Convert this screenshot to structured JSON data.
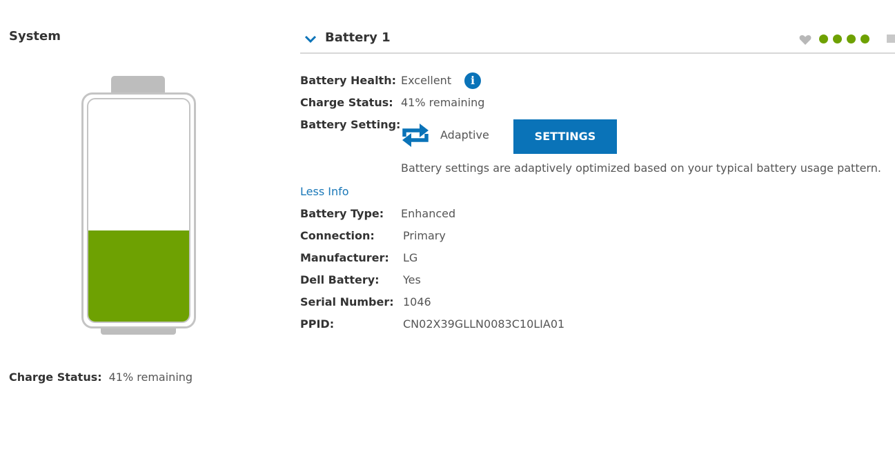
{
  "system": {
    "title": "System"
  },
  "battery_graphic": {
    "charge_level": 0.41,
    "fill_color": "#6ea102"
  },
  "left_charge": {
    "label": "Charge Status:",
    "value": "41% remaining"
  },
  "header": {
    "title": "Battery 1",
    "chevron_icon": "chevron-down-icon",
    "health_icon": "heart-icon",
    "health_dots_filled": 4,
    "accent_color": "#0a73b8"
  },
  "details": {
    "health_label": "Battery Health:",
    "health_value": "Excellent",
    "charge_label": "Charge Status:",
    "charge_value": "41% remaining",
    "setting_label": "Battery Setting:",
    "setting_value": "Adaptive",
    "settings_button": "SETTINGS",
    "setting_description": "Battery settings are adaptively optimized based on your typical battery usage pattern.",
    "less_info": "Less Info",
    "type_label": "Battery Type:",
    "type_value": "Enhanced",
    "connection_label": "Connection:",
    "connection_value": "Primary",
    "manufacturer_label": "Manufacturer:",
    "manufacturer_value": "LG",
    "dell_label": "Dell Battery:",
    "dell_value": "Yes",
    "serial_label": "Serial Number:",
    "serial_value": "1046",
    "ppid_label": "PPID:",
    "ppid_value": "CN02X39GLLN0083C10LIA01"
  }
}
